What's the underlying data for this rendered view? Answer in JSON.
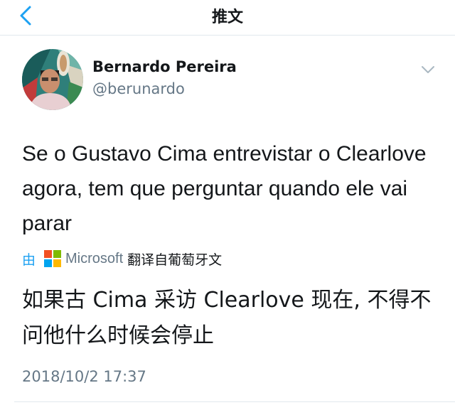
{
  "header": {
    "title": "推文"
  },
  "tweet": {
    "author": {
      "display_name": "Bernardo Pereira",
      "handle": "@berunardo"
    },
    "text": "Se o Gustavo Cima entrevistar o Clearlove agora, tem que perguntar quando ele vai parar",
    "translation": {
      "prefix": "由",
      "provider": "Microsoft",
      "suffix": "翻译自葡萄牙文",
      "text": "如果古 Cima 采访 Clearlove 现在, 不得不问他什么时候会停止"
    },
    "timestamp": "2018/10/2 17:37"
  },
  "colors": {
    "accent": "#1da1f2",
    "secondary_text": "#657786",
    "primary_text": "#14171a",
    "divider": "#e1e8ed",
    "ms_red": "#f25022",
    "ms_green": "#7fba00",
    "ms_blue": "#00a4ef",
    "ms_yellow": "#ffb900"
  },
  "icons": {
    "back": "chevron-left-icon",
    "menu": "chevron-down-icon",
    "provider": "microsoft-logo-icon"
  }
}
